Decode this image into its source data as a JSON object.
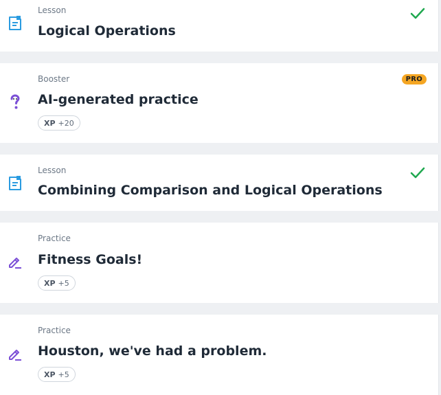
{
  "colors": {
    "lesson_icon": "#2a9be0",
    "purple_icon": "#7b4fd6",
    "check": "#1fa84f",
    "pro_badge": "#f5a623"
  },
  "items": [
    {
      "category": "Lesson",
      "title": "Logical Operations",
      "icon": "lesson-document-icon",
      "completed": true
    },
    {
      "category": "Booster",
      "title": "AI-generated practice",
      "icon": "question-mark-icon",
      "badge": "PRO",
      "xp_label": "XP",
      "xp_value": "+20"
    },
    {
      "category": "Lesson",
      "title": "Combining Comparison and Logical Operations",
      "icon": "lesson-document-icon",
      "completed": true
    },
    {
      "category": "Practice",
      "title": "Fitness Goals!",
      "icon": "pencil-edit-icon",
      "xp_label": "XP",
      "xp_value": "+5"
    },
    {
      "category": "Practice",
      "title": "Houston, we've had a problem.",
      "icon": "pencil-edit-icon",
      "xp_label": "XP",
      "xp_value": "+5"
    }
  ]
}
